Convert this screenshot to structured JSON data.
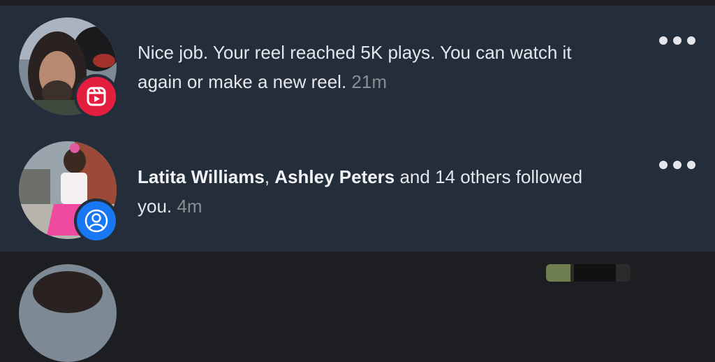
{
  "notifications": [
    {
      "text": "Nice job. Your reel reached 5K plays. You can watch it again or make a new reel.",
      "time": "21m",
      "badge_icon": "reel-icon",
      "badge_color": "#e41e3f"
    },
    {
      "bold_name_1": "Latita Williams",
      "separator": ", ",
      "bold_name_2": "Ashley Peters",
      "rest": " and 14 others followed you.",
      "time": "4m",
      "badge_icon": "person-icon",
      "badge_color": "#1877f2"
    }
  ],
  "colors": {
    "background": "#1c1e21",
    "card": "#242d3a",
    "text": "#e4e6eb",
    "muted": "#8a8d91"
  }
}
